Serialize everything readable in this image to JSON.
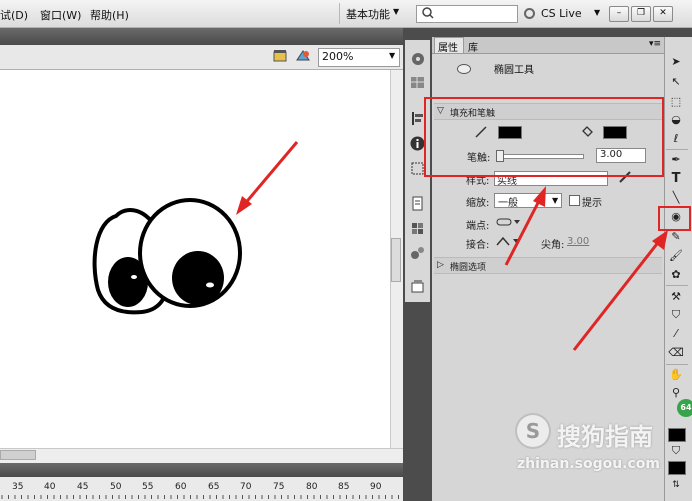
{
  "menubar": {
    "items": [
      "试(D)",
      "窗口(W)",
      "帮助(H)"
    ],
    "workspace_label": "基本功能",
    "search_placeholder": "",
    "cslive_label": "CS Live"
  },
  "editbar": {
    "zoom": "200%"
  },
  "panel": {
    "tabs": [
      "属性",
      "库"
    ],
    "tool_name": "椭圆工具",
    "fill_stroke_section": "填充和笔触",
    "stroke_label": "笔触:",
    "stroke_value": "3.00",
    "style_label": "样式:",
    "style_value": "实线",
    "scale_label": "缩放:",
    "scale_value": "一般",
    "hint_label": "提示",
    "cap_label": "端点:",
    "join_label": "接合:",
    "miter_label": "尖角:",
    "miter_value": "3.00",
    "ellipse_options_section": "椭圆选项"
  },
  "ruler": {
    "ticks": [
      "35",
      "40",
      "45",
      "50",
      "55",
      "60",
      "65",
      "70",
      "75",
      "80",
      "85",
      "90"
    ]
  },
  "tools": {
    "text_tool": "T"
  },
  "watermark": {
    "logo_letter": "S",
    "brand": "搜狗指南",
    "url": "zhinan.sogou.com",
    "badge": "64"
  },
  "colors": {
    "highlight": "#e02525",
    "stroke": "#000000",
    "fill": "#000000"
  }
}
